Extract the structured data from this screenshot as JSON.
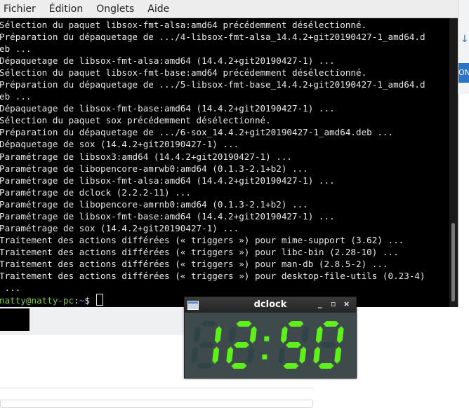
{
  "terminal": {
    "menu": [
      "Fichier",
      "Édition",
      "Onglets",
      "Aide"
    ],
    "lines": [
      "Sélection du paquet libsox-fmt-alsa:amd64 précédemment désélectionné.",
      "Préparation du dépaquetage de .../4-libsox-fmt-alsa_14.4.2+git20190427-1_amd64.d",
      "eb ...",
      "Dépaquetage de libsox-fmt-alsa:amd64 (14.4.2+git20190427-1) ...",
      "Sélection du paquet libsox-fmt-base:amd64 précédemment désélectionné.",
      "Préparation du dépaquetage de .../5-libsox-fmt-base_14.4.2+git20190427-1_amd64.d",
      "eb ...",
      "Dépaquetage de libsox-fmt-base:amd64 (14.4.2+git20190427-1) ...",
      "Sélection du paquet sox précédemment désélectionné.",
      "Préparation du dépaquetage de .../6-sox_14.4.2+git20190427-1_amd64.deb ...",
      "Dépaquetage de sox (14.4.2+git20190427-1) ...",
      "Paramétrage de libsox3:amd64 (14.4.2+git20190427-1) ...",
      "Paramétrage de libopencore-amrwb0:amd64 (0.1.3-2.1+b2) ...",
      "Paramétrage de libsox-fmt-alsa:amd64 (14.4.2+git20190427-1) ...",
      "Paramétrage de dclock (2.2.2-11) ...",
      "Paramétrage de libopencore-amrnb0:amd64 (0.1.3-2.1+b2) ...",
      "Paramétrage de libsox-fmt-base:amd64 (14.4.2+git20190427-1) ...",
      "Paramétrage de sox (14.4.2+git20190427-1) ...",
      "Traitement des actions différées (« triggers ») pour mime-support (3.62) ...",
      "Traitement des actions différées (« triggers ») pour libc-bin (2.28-10) ...",
      "Traitement des actions différées (« triggers ») pour man-db (2.8.5-2) ...",
      "Traitement des actions différées (« triggers ») pour desktop-file-utils (0.23-4)",
      " ..."
    ],
    "prompt_user": "natty@natty-pc",
    "prompt_sep": ":",
    "prompt_path": "~",
    "prompt_end": "$ "
  },
  "background_window": {
    "tab_text": "ON"
  },
  "dclock": {
    "title": "dclock",
    "minimize": "_",
    "maximize": "▫",
    "close": "×",
    "time": "12:50",
    "colors": {
      "on": "#5ff01c",
      "off": "#2e4446",
      "bg": "#3e4a4c"
    }
  }
}
